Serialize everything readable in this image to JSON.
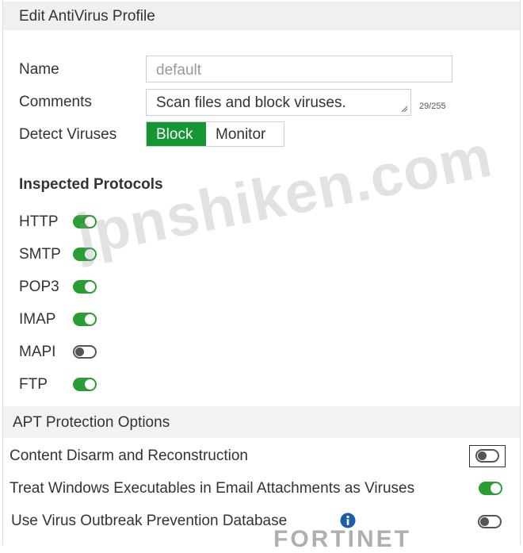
{
  "dialog": {
    "title": "Edit AntiVirus Profile"
  },
  "form": {
    "name": {
      "label": "Name",
      "value": "default"
    },
    "comments": {
      "label": "Comments",
      "value": "Scan files and block viruses.",
      "counter": "29/255"
    },
    "detect_viruses": {
      "label": "Detect Viruses",
      "options": [
        "Block",
        "Monitor"
      ],
      "selected": "Block"
    }
  },
  "inspected_protocols": {
    "title": "Inspected Protocols",
    "items": [
      {
        "label": "HTTP",
        "enabled": true
      },
      {
        "label": "SMTP",
        "enabled": true
      },
      {
        "label": "POP3",
        "enabled": true
      },
      {
        "label": "IMAP",
        "enabled": true
      },
      {
        "label": "MAPI",
        "enabled": false
      },
      {
        "label": "FTP",
        "enabled": true
      }
    ]
  },
  "apt": {
    "title": "APT Protection Options",
    "items": [
      {
        "label": "Content Disarm and Reconstruction",
        "enabled": false
      },
      {
        "label": "Treat Windows Executables in Email Attachments as Viruses",
        "enabled": true
      },
      {
        "label": "Use Virus Outbreak Prevention Database",
        "enabled": false
      }
    ]
  },
  "watermark": {
    "text": "jpnshiken.com",
    "brand": "FORTINET"
  },
  "colors": {
    "accent": "#169534",
    "toggle_on": "#2a9d34",
    "header_bg": "#f0f0f0"
  }
}
